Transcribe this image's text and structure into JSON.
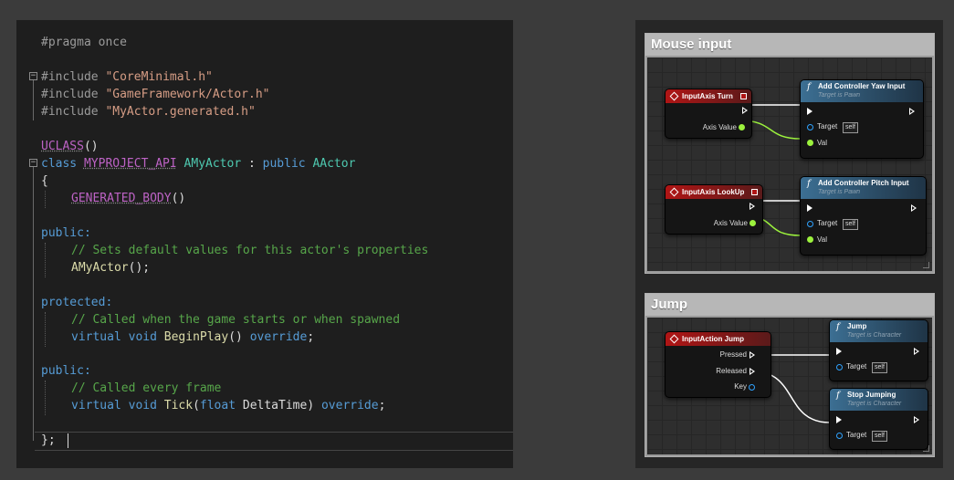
{
  "editor": {
    "lines": {
      "pragma": "#pragma once",
      "inc1_kw": "#include",
      "inc1_file": "\"CoreMinimal.h\"",
      "inc2_kw": "#include",
      "inc2_file": "\"GameFramework/Actor.h\"",
      "inc3_kw": "#include",
      "inc3_file": "\"MyActor.generated.h\"",
      "uclass": "UCLASS",
      "uclass_parens": "()",
      "class_kw": "class",
      "api_macro": "MYPROJECT_API",
      "class_name": "AMyActor",
      "class_colon": " : ",
      "public_kw": "public",
      "base_class": "AActor",
      "open_brace": "{",
      "generated_body": "GENERATED_BODY",
      "generated_parens": "()",
      "public1": "public:",
      "comment1": "// Sets default values for this actor's properties",
      "ctor": "AMyActor",
      "ctor_tail": "();",
      "protected": "protected:",
      "comment2": "// Called when the game starts or when spawned",
      "virtual1": "virtual",
      "void1": "void",
      "beginplay": "BeginPlay",
      "beginplay_parens": "() ",
      "override1": "override",
      "semi1": ";",
      "public2": "public:",
      "comment3": "// Called every frame",
      "virtual2": "virtual",
      "void2": "void",
      "tick": "Tick",
      "tick_open": "(",
      "float_kw": "float",
      "tick_param": " DeltaTime) ",
      "override2": "override",
      "semi2": ";",
      "close": "};"
    },
    "fold_symbols": {
      "include": "−",
      "class": "−"
    }
  },
  "blueprint": {
    "mouse_input": {
      "title": "Mouse input",
      "turn_event": {
        "title": "InputAxis Turn",
        "pin": "Axis Value"
      },
      "yaw_func": {
        "title": "Add Controller Yaw Input",
        "subtitle": "Target is Pawn",
        "target": "Target",
        "self": "self",
        "val": "Val"
      },
      "lookup_event": {
        "title": "InputAxis LookUp",
        "pin": "Axis Value"
      },
      "pitch_func": {
        "title": "Add Controller Pitch Input",
        "subtitle": "Target is Pawn",
        "target": "Target",
        "self": "self",
        "val": "Val"
      }
    },
    "jump": {
      "title": "Jump",
      "action_event": {
        "title": "InputAction Jump",
        "pressed": "Pressed",
        "released": "Released",
        "key": "Key"
      },
      "jump_func": {
        "title": "Jump",
        "subtitle": "Target is Character",
        "target": "Target",
        "self": "self"
      },
      "stop_func": {
        "title": "Stop Jumping",
        "subtitle": "Target is Character",
        "target": "Target",
        "self": "self"
      }
    },
    "func_icon": "f"
  },
  "colors": {
    "editor_bg": "#1e1e1e",
    "keyword": "#569cd6",
    "string": "#d69d85",
    "type": "#4ec9b0",
    "function": "#dcdcaa",
    "comment": "#57a64a",
    "macro": "#bd63c5",
    "event_header": "#b01515",
    "function_header": "#3c6f93",
    "float_pin": "#9cf23d",
    "object_pin": "#2fa3ff"
  }
}
